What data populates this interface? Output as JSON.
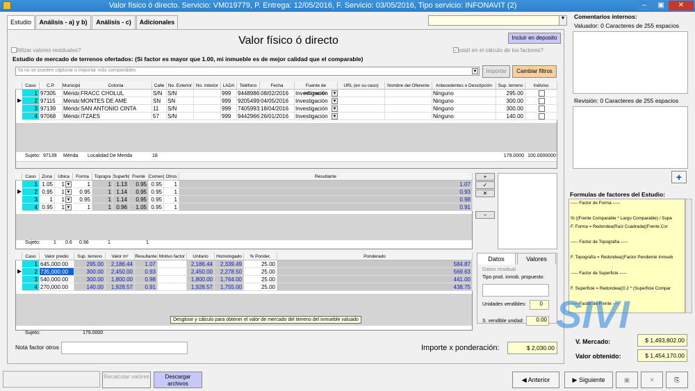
{
  "window": {
    "title": "Valor físico ó directo. Servicio: VM019779, P. Entrega: 12/05/2016, F. Servicio: 03/05/2016, Tipo servicio: INFONAVIT (2)",
    "minimize": "–",
    "maximize": "▣",
    "close": "✕"
  },
  "tabs": [
    "Estudio",
    "Análisis - a) y b)",
    "Análisis - c)",
    "Adicionales"
  ],
  "header": {
    "title": "Valor físico ó directo",
    "include_button": "Incluir en deposito",
    "residual_checkbox": "¿Utilizar valores residuales?",
    "assisted_checkbox": "¿Asistí en el cálculo de los factores?"
  },
  "market_study": {
    "heading": "Estudio de mercado de terrenos ofertados: (Si factor es mayor que 1.00, mi inmueble es de mejor calidad que el comparable)",
    "search_placeholder": "Ya no se pueden capturar o importar más comparables",
    "import_button": "Importar",
    "filter_button": "Cambiar filtros",
    "columns": [
      "Caso",
      "C.P.",
      "Municipio",
      "Colonia",
      "Calle",
      "No. Exterior",
      "No. Interior",
      "LADA",
      "Teléfono",
      "Fecha",
      "Fuente de información",
      "URL (en su caso)",
      "Nombre del Oferente",
      "Antecedentes o Descripción",
      "Sup. terreno",
      "Indiviso"
    ],
    "rows": [
      {
        "caso": "1",
        "cp": "97305",
        "municipio": "Mérida",
        "colonia": "FRACC CHOLUL",
        "calle": "S/N",
        "ext": "S/N",
        "lada": "999",
        "tel": "9448986",
        "fecha": "08/02/2016",
        "fuente": "Investigación",
        "antecedentes": "Ninguno",
        "sup": "295.00"
      },
      {
        "caso": "2",
        "cp": "97115",
        "municipio": "Mérida",
        "colonia": "MONTES DE AME",
        "calle": "SN",
        "ext": "SN",
        "lada": "999",
        "tel": "9205499",
        "fecha": "04/05/2016",
        "fuente": "Investigación",
        "antecedentes": "Ninguno",
        "sup": "300.00"
      },
      {
        "caso": "3",
        "cp": "97139",
        "municipio": "Mérida",
        "colonia": "SAN ANTONIO CINTA",
        "calle": "11",
        "ext": "S/N",
        "lada": "999",
        "tel": "7405993",
        "fecha": "18/04/2016",
        "fuente": "Investigación",
        "antecedentes": "Ninguno",
        "sup": "300.00"
      },
      {
        "caso": "4",
        "cp": "97068",
        "municipio": "Mérida",
        "colonia": "ITZAES",
        "calle": "57",
        "ext": "S/N",
        "lada": "999",
        "tel": "9442966",
        "fecha": "26/01/2016",
        "fuente": "Investigación",
        "antecedentes": "Ninguno",
        "sup": "140.00"
      }
    ],
    "subject": {
      "label": "Sujeto:",
      "cp": "97139",
      "municipio": "Mérida",
      "colonia": "Localidad De Merida",
      "calle": "18",
      "sup": "179.0000",
      "indiviso": "100.0000000"
    }
  },
  "factors": {
    "columns": [
      "Caso",
      "Zona",
      "Ubica",
      "Forma",
      "Topogra",
      "Superfic",
      "Frente",
      "Comerc.",
      "Otros",
      "Resultante"
    ],
    "rows": [
      {
        "caso": "1",
        "zona": "1.05",
        "ubica": "1",
        "forma": "1",
        "topo": "1",
        "sup": "1.13",
        "frente": "0.95",
        "comerc": "0.95",
        "otros": "1",
        "res": "1.07"
      },
      {
        "caso": "2",
        "zona": "0.95",
        "ubica": "1",
        "forma": "0.95",
        "topo": "1",
        "sup": "1.14",
        "frente": "0.95",
        "comerc": "0.95",
        "otros": "1",
        "res": "0.93"
      },
      {
        "caso": "3",
        "zona": "1",
        "ubica": "1",
        "forma": "0.95",
        "topo": "1",
        "sup": "1.14",
        "frente": "0.95",
        "comerc": "0.95",
        "otros": "1",
        "res": "0.98"
      },
      {
        "caso": "4",
        "zona": "0.95",
        "ubica": "1",
        "forma": "1",
        "topo": "1",
        "sup": "0.96",
        "frente": "1.05",
        "comerc": "0.95",
        "otros": "1",
        "res": "0.91"
      }
    ],
    "subject": {
      "label": "Sujeto:",
      "zona": "1",
      "ubica": "0.6",
      "forma": "0.96",
      "topo": "1",
      "frente": "1"
    },
    "buttons": [
      "+",
      "✓",
      "✕",
      "−"
    ]
  },
  "values": {
    "columns": [
      "Caso",
      "Valor predio",
      "Sup. terreno",
      "Valor m²",
      "Resultante",
      "Motivo factor",
      "Unitario",
      "Homologado",
      "% Ponder.",
      "Ponderado"
    ],
    "rows": [
      {
        "caso": "1",
        "predio": "645,000.00",
        "sup": "295.00",
        "m2": "2,186.44",
        "res": "1.07",
        "unit": "2,186.44",
        "hom": "2,339.49",
        "pond": "25.00",
        "ponderado": "584.87"
      },
      {
        "caso": "2",
        "predio": "735,000.00",
        "sup": "300.00",
        "m2": "2,450.00",
        "res": "0.93",
        "unit": "2,450.00",
        "hom": "2,278.50",
        "pond": "25.00",
        "ponderado": "569.63"
      },
      {
        "caso": "3",
        "predio": "540,000.00",
        "sup": "300.00",
        "m2": "1,800.00",
        "res": "0.98",
        "unit": "1,800.00",
        "hom": "1,764.00",
        "pond": "25.00",
        "ponderado": "441.00"
      },
      {
        "caso": "4",
        "predio": "270,000.00",
        "sup": "140.00",
        "m2": "1,928.57",
        "res": "0.91",
        "unit": "1,928.57",
        "hom": "1,755.00",
        "pond": "25.00",
        "ponderado": "438.75"
      }
    ],
    "subject": {
      "label": "Sujeto:",
      "sup": "179.0000"
    },
    "tooltip": "Desglose y cálculo para obtener el valor de mercado del terreno del inmueble valuado"
  },
  "side_tabs": {
    "tabs": [
      "Datos",
      "Valores"
    ],
    "group": "Datos residual",
    "tipo_prod": "Tipo prod. inmob. propuesto:",
    "unidades": "Unidades vendibles:",
    "unidades_val": "0",
    "s_vendible": "S. vendible unidad:",
    "s_vendible_val": "0.00"
  },
  "nota_label": "Nota factor otros",
  "importe": {
    "label": "Importe x ponderación:",
    "value": "$ 2,030.00"
  },
  "right_panel": {
    "heading": "Comentarios internos:",
    "valuador": "Valuador: 0 Caracteres de 255 espacios",
    "revision": "Revisión: 0 Caracteres de 255 espacios",
    "add": "+",
    "formulas_heading": "Formulas de factores del Estudio:",
    "formulas": [
      "----- Factor de Forma -----",
      "",
      "Si ((Frente Comparable * Largo Comparable) / Supe",
      "    F. Forma = Redondea(Raíz Cuadrada((Frente Cor",
      "",
      "----- Factor de Topografía -----",
      "",
      "F. Topografía = Redondea((Factor Pendiente Inmueb",
      "",
      "----- Factor de Superficie -----",
      "",
      "F. Superficie = Redondea((0.2 * (Superficie Compar",
      "",
      "----- Factor de Frente -----",
      "",
      "F. Frente = Redondea((Frente Predio Inmueble / Fre"
    ],
    "mercado_label": "V. Mercado:",
    "mercado_value": "$ 1,493,802.00",
    "obtenido_label": "Valor obtenido:",
    "obtenido_value": "$ 1,454,170.00",
    "logo": "SIVI"
  },
  "bottom": {
    "recalc": "Recalcular valores",
    "descargar": "Descargar archivos",
    "anterior": "Anterior",
    "siguiente": "Siguiente"
  }
}
